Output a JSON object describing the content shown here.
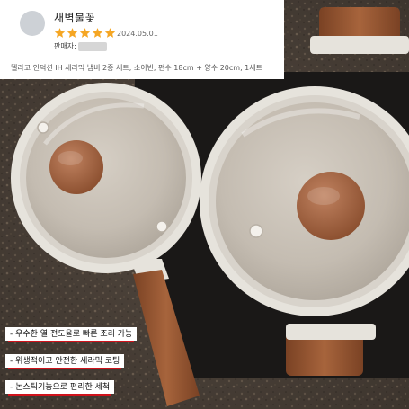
{
  "review": {
    "reviewer_name": "새벽불꽃",
    "rating": 5,
    "date": "2024.05.01",
    "seller_label": "판매자:",
    "product_option": "델라고 인덕션 IH 세라믹 냄비 2종 세트, 소이빈, 편수 18cm + 양수 20cm, 1세트"
  },
  "features": [
    "- 우수한 열 전도율로 빠른 조리 가능",
    "- 위생적이고 안전한 세라믹 코팅",
    "- 논스틱기능으로 편리한 세척"
  ],
  "colors": {
    "star": "#f5a623",
    "underline": "#d0121b",
    "pot_body": "#e6e3dc",
    "wood": "#9a5a36",
    "cooktop": "#1a1817"
  },
  "icons": [
    "star-icon",
    "avatar-icon"
  ]
}
